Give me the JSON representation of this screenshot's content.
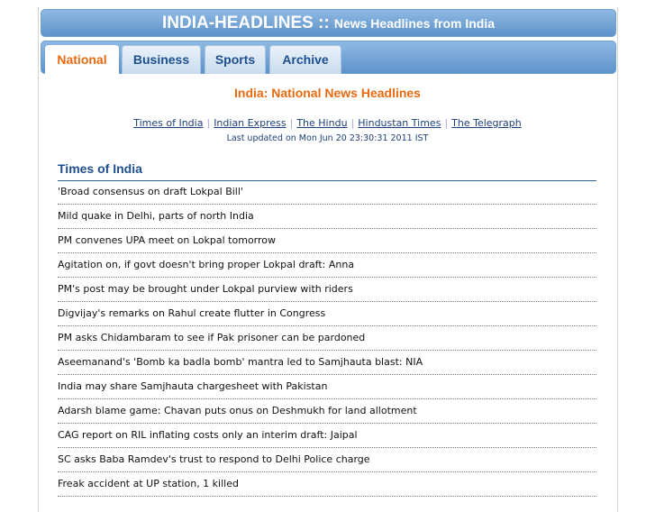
{
  "header": {
    "brand": "INDIA-HEADLINES ::",
    "subtitle": "News Headlines from India"
  },
  "tabs": [
    {
      "label": "National",
      "active": true
    },
    {
      "label": "Business",
      "active": false
    },
    {
      "label": "Sports",
      "active": false
    },
    {
      "label": "Archive",
      "active": false
    }
  ],
  "page_title": "India: National News Headlines",
  "sources": [
    "Times of India",
    "Indian Express",
    "The Hindu",
    "Hindustan Times",
    "The Telegraph"
  ],
  "last_updated": "Last updated on Mon Jun 20 23:30:31 2011 IST",
  "section": {
    "title": "Times of India",
    "headlines": [
      "'Broad consensus on draft Lokpal Bill'",
      "Mild quake in Delhi, parts of north India",
      "PM convenes UPA meet on Lokpal tomorrow",
      "Agitation on, if govt doesn't bring proper Lokpal draft: Anna",
      "PM's post may be brought under Lokpal purview with riders",
      "Digvijay's remarks on Rahul create flutter in Congress",
      "PM asks Chidambaram to see if Pak prisoner can be pardoned",
      "Aseemanand's 'Bomb ka badla bomb' mantra led to Samjhauta blast: NIA",
      "India may share Samjhauta chargesheet with Pakistan",
      "Adarsh blame game: Chavan puts onus on Deshmukh for land allotment",
      "CAG report on RIL inflating costs only an interim draft: Jaipal",
      "SC asks Baba Ramdev's trust to respond to Delhi Police charge",
      "Freak accident at UP station, 1 killed"
    ]
  }
}
